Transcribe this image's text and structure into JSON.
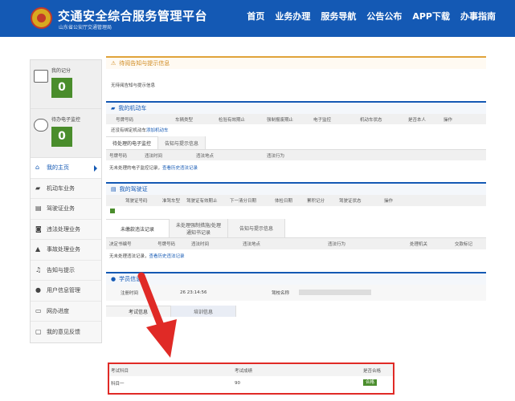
{
  "header": {
    "title": "交通安全综合服务管理平台",
    "subtitle": "山东省公安厅交通管理局",
    "nav": [
      "首页",
      "业务办理",
      "服务导航",
      "公告公布",
      "APP下载",
      "办事指南"
    ]
  },
  "sidebar": {
    "score_label": "我的记分",
    "score_value": "0",
    "monitor_label": "待办电子监控",
    "monitor_value": "0",
    "items": [
      {
        "label": "我的主页",
        "icon": "home-icon"
      },
      {
        "label": "机动车业务",
        "icon": "truck-icon"
      },
      {
        "label": "驾驶证业务",
        "icon": "card-icon"
      },
      {
        "label": "违法处理业务",
        "icon": "camera-icon"
      },
      {
        "label": "事故处理业务",
        "icon": "warning-icon"
      },
      {
        "label": "告知与提示",
        "icon": "bell-icon"
      },
      {
        "label": "用户信息管理",
        "icon": "user-icon"
      },
      {
        "label": "网办进度",
        "icon": "progress-icon"
      },
      {
        "label": "我的意见反馈",
        "icon": "feedback-icon"
      }
    ]
  },
  "notice": {
    "title": "待阅告知与提示信息",
    "body": "无待阅告知与提示信息"
  },
  "vehicles": {
    "title": "我的机动车",
    "columns": [
      "号牌号码",
      "车辆类型",
      "检验有效期止",
      "强制报废期止",
      "电子监控",
      "机动车状态",
      "是否本人",
      "操作"
    ],
    "empty_text": "还没有绑定机动车",
    "add_link": "添加机动车",
    "tabs": [
      "待处理的电子监控",
      "告知与提示信息"
    ],
    "sub_columns": [
      "号牌号码",
      "违法时间",
      "违法地点",
      "违法行为"
    ],
    "sub_empty": "无未处理的电子监控记录，",
    "sub_link": "查看历史违法记录"
  },
  "license": {
    "title": "我的驾驶证",
    "columns": [
      "驾驶证号码",
      "准驾车型",
      "驾驶证有效期止",
      "下一清分日期",
      "体检日期",
      "累积记分",
      "驾驶证状态",
      "操作"
    ],
    "tabs": [
      "未缴款违法记录",
      "未处理强制措施/处理",
      "通知书记录",
      "告知与提示信息"
    ],
    "sub_columns": [
      "决定书编号",
      "号牌号码",
      "违法时间",
      "违法地点",
      "违法行为",
      "处理机关",
      "交款标记"
    ],
    "sub_empty": "无未处理违法记录，",
    "sub_link": "查看历史违法记录"
  },
  "student": {
    "title": "学员信息",
    "reg_time_label": "注册时间",
    "reg_time_value": "26 23:14:56",
    "school_label": "驾校名称",
    "tabs": [
      "考试信息",
      "培训信息"
    ],
    "exam_columns": [
      "考试科目",
      "考试成绩",
      "是否合格"
    ],
    "exam_rows": [
      {
        "subject": "科目一",
        "score": "90",
        "result": "合格"
      }
    ]
  },
  "colors": {
    "header_blue": "#1459b4",
    "score_green": "#4a8d2c",
    "highlight_red": "#e02a26"
  }
}
